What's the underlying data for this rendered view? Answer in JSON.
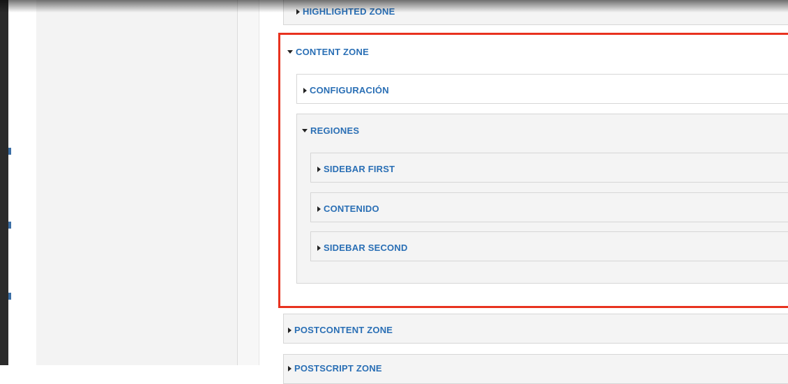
{
  "zones": {
    "highlighted": "HIGHLIGHTED ZONE",
    "content": "CONTENT ZONE",
    "postcontent": "POSTCONTENT ZONE",
    "postscript": "POSTSCRIPT ZONE"
  },
  "content_zone": {
    "configuracion": "CONFIGURACIÓN",
    "regiones": "REGIONES",
    "regions": [
      "SIDEBAR FIRST",
      "CONTENIDO",
      "SIDEBAR SECOND"
    ]
  },
  "colors": {
    "link": "#2a6fb5",
    "highlight_border": "#e8321f",
    "panel_bg": "#f4f4f4"
  },
  "icons": {
    "collapsed": "triangle-right-icon",
    "expanded": "triangle-down-icon"
  }
}
